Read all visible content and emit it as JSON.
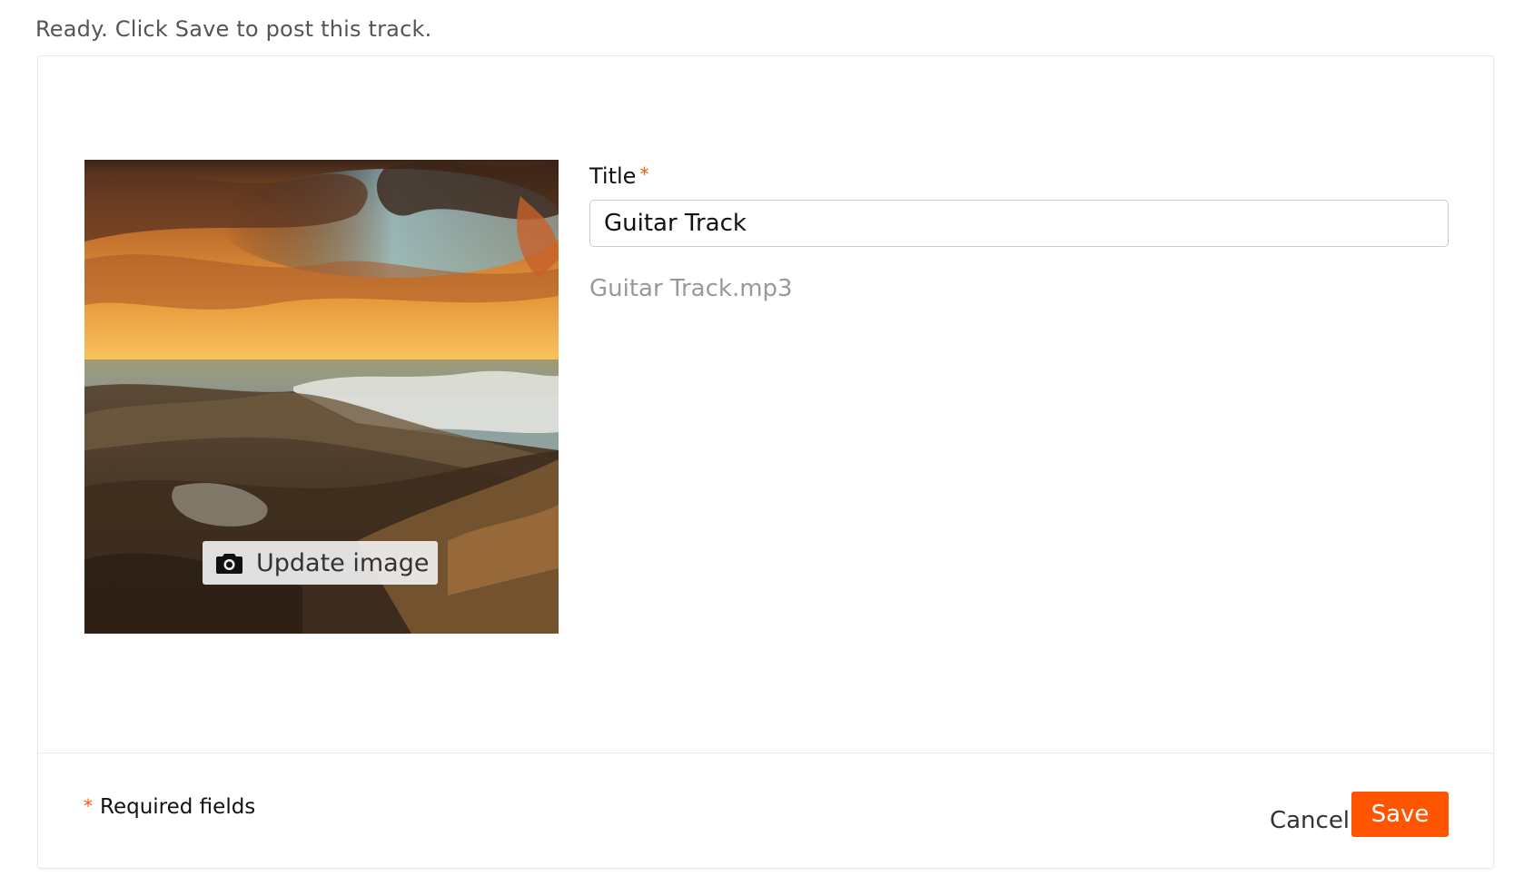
{
  "status": {
    "message": "Ready. Click Save to post this track."
  },
  "artwork": {
    "update_label": "Update image",
    "camera_icon": "camera-icon"
  },
  "form": {
    "title_label": "Title",
    "required_marker": "*",
    "title_value": "Guitar Track",
    "filename": "Guitar Track.mp3"
  },
  "footer": {
    "required_note": "Required fields",
    "cancel_label": "Cancel",
    "save_label": "Save"
  },
  "colors": {
    "accent": "#ff5500"
  }
}
